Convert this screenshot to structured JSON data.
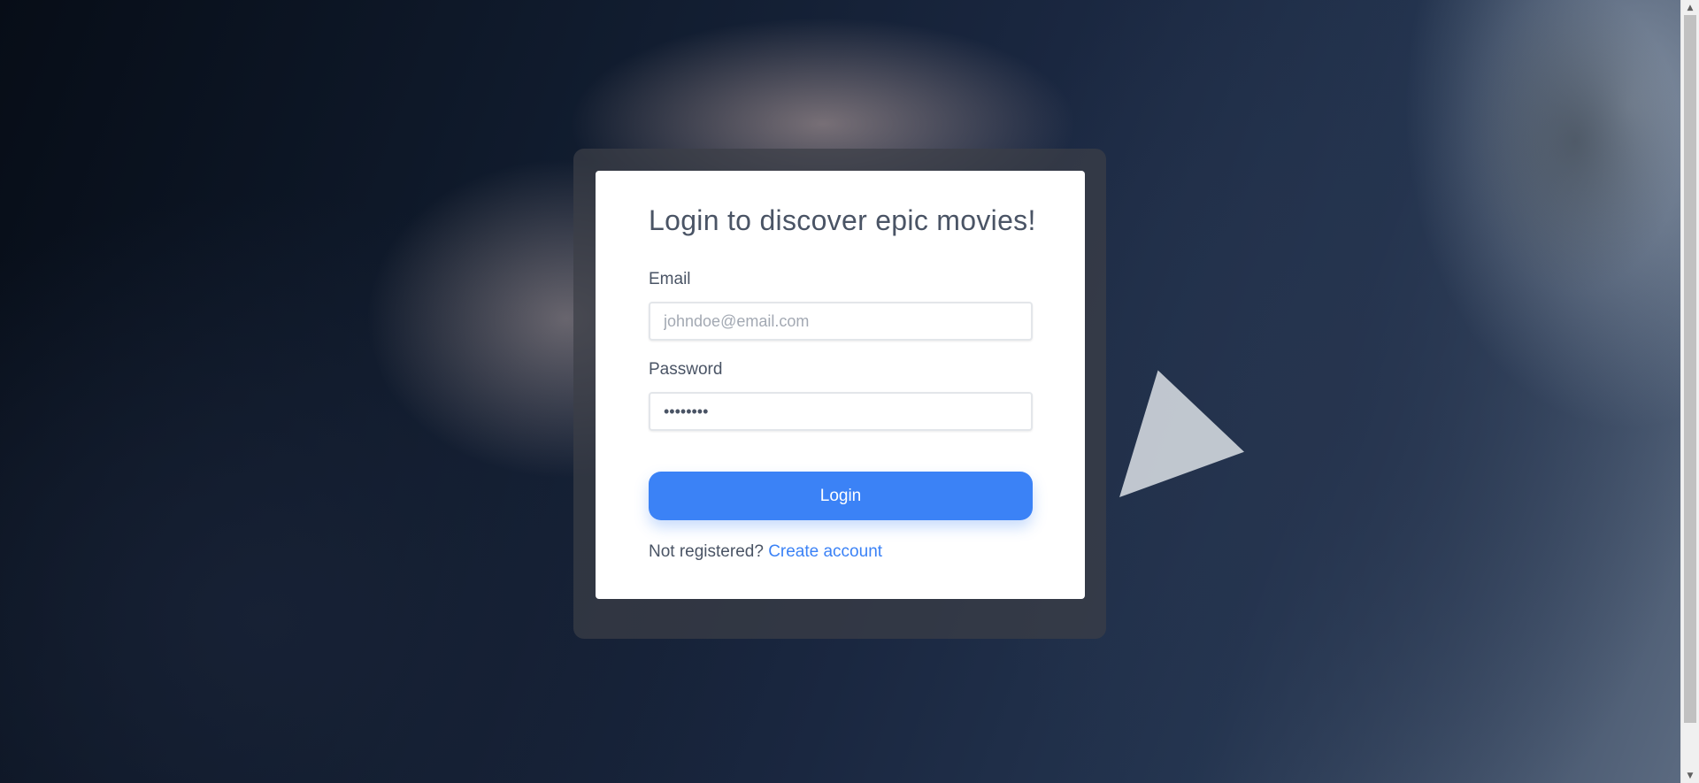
{
  "login": {
    "title": "Login to discover epic movies!",
    "email_label": "Email",
    "email_placeholder": "johndoe@email.com",
    "email_value": "",
    "password_label": "Password",
    "password_value": "••••••••",
    "submit_label": "Login",
    "register_prompt": "Not registered?",
    "register_link": "Create account"
  },
  "scrollbar": {
    "up_icon": "▲",
    "down_icon": "▼"
  },
  "colors": {
    "accent": "#3b82f6",
    "text": "#4a5465",
    "card": "#ffffff"
  }
}
